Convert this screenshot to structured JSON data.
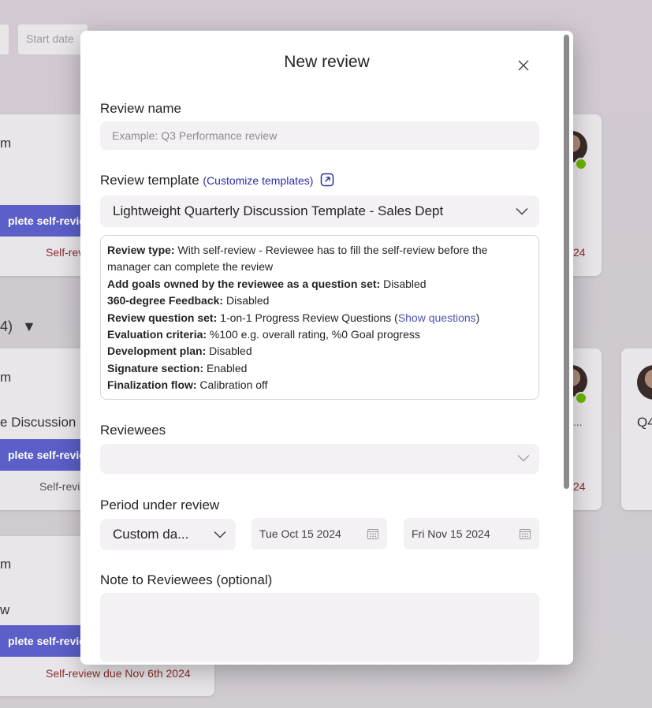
{
  "background": {
    "start_date_placeholder": "Start date",
    "card1": {
      "title_fragment": "m",
      "button": "plete self-review",
      "due": "Self-revi",
      "due_right": "24"
    },
    "group_header": "4)",
    "group_toggle": "▼",
    "card2": {
      "title_fragment": "m",
      "subtitle": "e Discussion",
      "button": "plete self-review",
      "due": "Self-revi",
      "due_right": "24",
      "ellipsis": "..."
    },
    "card3": {
      "title_fragment": "m",
      "subtitle": "w",
      "button": "plete self-review",
      "due": "Self-review due Nov 6th 2024"
    },
    "card4": {
      "title_fragment": "Q4"
    }
  },
  "dialog": {
    "title": "New review",
    "close_icon": "close-icon",
    "review_name": {
      "label": "Review name",
      "placeholder": "Example: Q3 Performance review",
      "value": ""
    },
    "review_template": {
      "label": "Review template",
      "customize_link": "(Customize templates)",
      "selected": "Lightweight Quarterly Discussion Template - Sales Dept"
    },
    "template_details": [
      {
        "key": "Review type:",
        "value": " With self-review - Reviewee has to fill the self-review before the manager can complete the review"
      },
      {
        "key": "Add goals owned by the reviewee as a question set:",
        "value": " Disabled"
      },
      {
        "key": "360-degree Feedback:",
        "value": " Disabled"
      },
      {
        "key": "Review question set:",
        "value": " 1-on-1 Progress Review Questions (",
        "link": "Show questions",
        "suffix": ")"
      },
      {
        "key": "Evaluation criteria:",
        "value": " %100 e.g. overall rating, %0 Goal progress"
      },
      {
        "key": "Development plan:",
        "value": " Disabled"
      },
      {
        "key": "Signature section:",
        "value": " Enabled"
      },
      {
        "key": "Finalization flow:",
        "value": " Calibration off"
      }
    ],
    "reviewees": {
      "label": "Reviewees",
      "value": ""
    },
    "period": {
      "label": "Period under review",
      "type": "Custom da...",
      "start": "Tue Oct 15 2024",
      "end": "Fri Nov 15 2024"
    },
    "note": {
      "label": "Note to Reviewees (optional)",
      "value": ""
    }
  },
  "colors": {
    "accent": "#5b5fc7",
    "link": "#2b2ea8",
    "input_bg": "#f3f1f3",
    "due_text": "#8a2d2d",
    "presence": "#6bb700"
  }
}
